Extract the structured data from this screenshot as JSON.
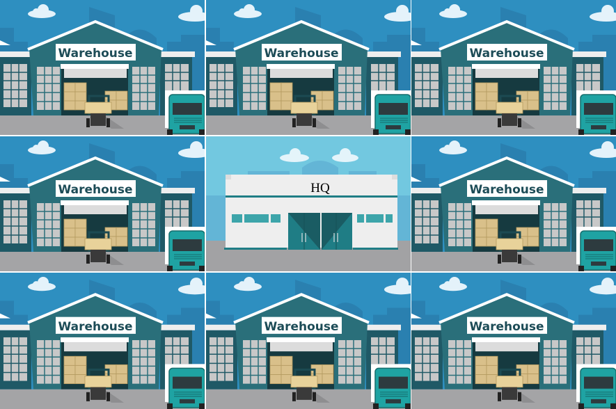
{
  "tiles": [
    {
      "label": "Warehouse",
      "kind": "warehouse"
    },
    {
      "label": "Warehouse",
      "kind": "warehouse"
    },
    {
      "label": "Warehouse",
      "kind": "warehouse"
    },
    {
      "label": "Warehouse",
      "kind": "warehouse"
    },
    {
      "label": "HQ",
      "kind": "headquarters"
    },
    {
      "label": "Warehouse",
      "kind": "warehouse"
    },
    {
      "label": "Warehouse",
      "kind": "warehouse"
    },
    {
      "label": "Warehouse",
      "kind": "warehouse"
    },
    {
      "label": "Warehouse",
      "kind": "warehouse"
    }
  ],
  "colors": {
    "warehouse_sky": "#2e8fc0",
    "warehouse_building": "#2a6f7a",
    "hq_sky": "#72c8e0",
    "hq_door": "#1f7d85",
    "ground": "#a4a4a6",
    "truck": "#1fa3a3",
    "boxes": "#d9c08a"
  }
}
